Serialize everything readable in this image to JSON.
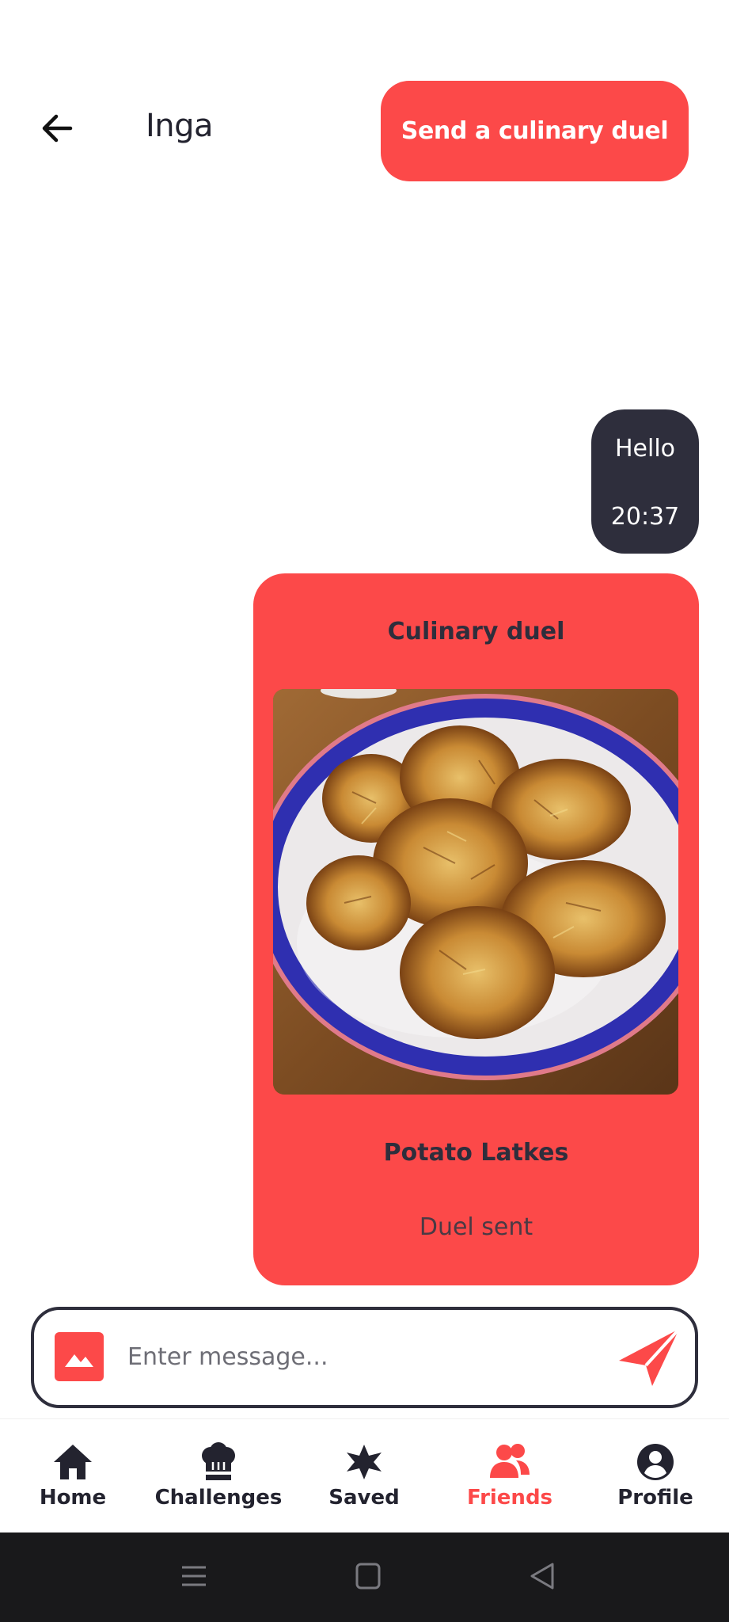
{
  "header": {
    "contact_name": "Inga",
    "duel_button_label": "Send a culinary duel"
  },
  "chat": {
    "messages": [
      {
        "text": "Hello",
        "time": "20:37"
      }
    ],
    "duel_card": {
      "title": "Culinary duel",
      "dish_name": "Potato Latkes",
      "status": "Duel sent"
    }
  },
  "composer": {
    "placeholder": "Enter message..."
  },
  "nav": {
    "items": [
      {
        "label": "Home",
        "icon": "home-icon"
      },
      {
        "label": "Challenges",
        "icon": "chef-hat-icon"
      },
      {
        "label": "Saved",
        "icon": "star-icon"
      },
      {
        "label": "Friends",
        "icon": "friends-icon",
        "active": true
      },
      {
        "label": "Profile",
        "icon": "profile-icon"
      }
    ]
  },
  "colors": {
    "accent": "#fc4949",
    "dark": "#2e2e3c",
    "system_bar": "#19191b"
  }
}
